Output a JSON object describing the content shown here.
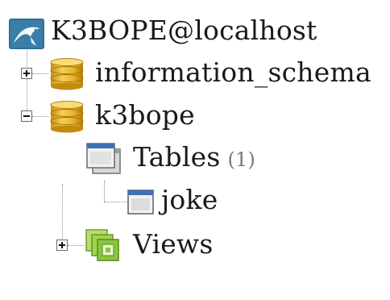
{
  "tree": {
    "connection": {
      "label": "K3BOPE@localhost",
      "icon": "mysql-dolphin-icon"
    },
    "databases": [
      {
        "label": "information_schema",
        "expanded": false,
        "icon": "database-icon"
      },
      {
        "label": "k3bope",
        "expanded": true,
        "icon": "database-icon",
        "tables": {
          "label": "Tables",
          "count": "(1)",
          "icon": "tables-folder-icon",
          "items": [
            {
              "label": "joke",
              "icon": "table-icon"
            }
          ]
        },
        "views": {
          "label": "Views",
          "expanded": false,
          "icon": "views-folder-icon"
        }
      }
    ]
  },
  "colors": {
    "db_gold": "#e7b32c",
    "dolphin_blue": "#2f6e95",
    "views_green": "#8cc63f",
    "table_blue": "#3f6fb6"
  }
}
